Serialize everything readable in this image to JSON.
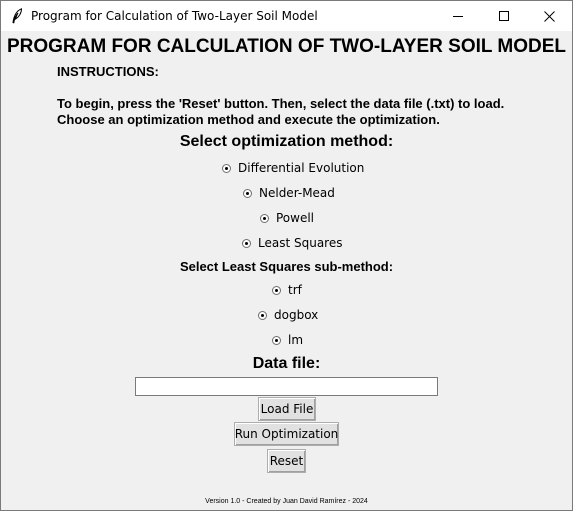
{
  "window": {
    "title": "Program for Calculation of Two-Layer Soil Model",
    "controls": [
      "minimize-icon",
      "maximize-icon",
      "close-icon"
    ]
  },
  "header": {
    "title": "PROGRAM FOR CALCULATION OF TWO-LAYER SOIL MODEL"
  },
  "instructions": {
    "heading": "INSTRUCTIONS:",
    "line1": "To begin, press the 'Reset' button. Then, select the data file (.txt) to load.",
    "line2": "Choose an optimization method and execute the optimization."
  },
  "optimization": {
    "heading": "Select optimization method:",
    "options": [
      {
        "label": "Differential Evolution"
      },
      {
        "label": "Nelder-Mead"
      },
      {
        "label": "Powell"
      },
      {
        "label": "Least Squares"
      }
    ]
  },
  "least_squares": {
    "heading": "Select Least Squares sub-method:",
    "options": [
      {
        "label": "trf"
      },
      {
        "label": "dogbox"
      },
      {
        "label": "lm"
      }
    ]
  },
  "data_file": {
    "heading": "Data file:",
    "value": ""
  },
  "buttons": {
    "load": "Load File",
    "run": "Run Optimization",
    "reset": "Reset"
  },
  "footer": {
    "text": "Version 1.0 - Created by Juan David Ramírez - 2024"
  }
}
